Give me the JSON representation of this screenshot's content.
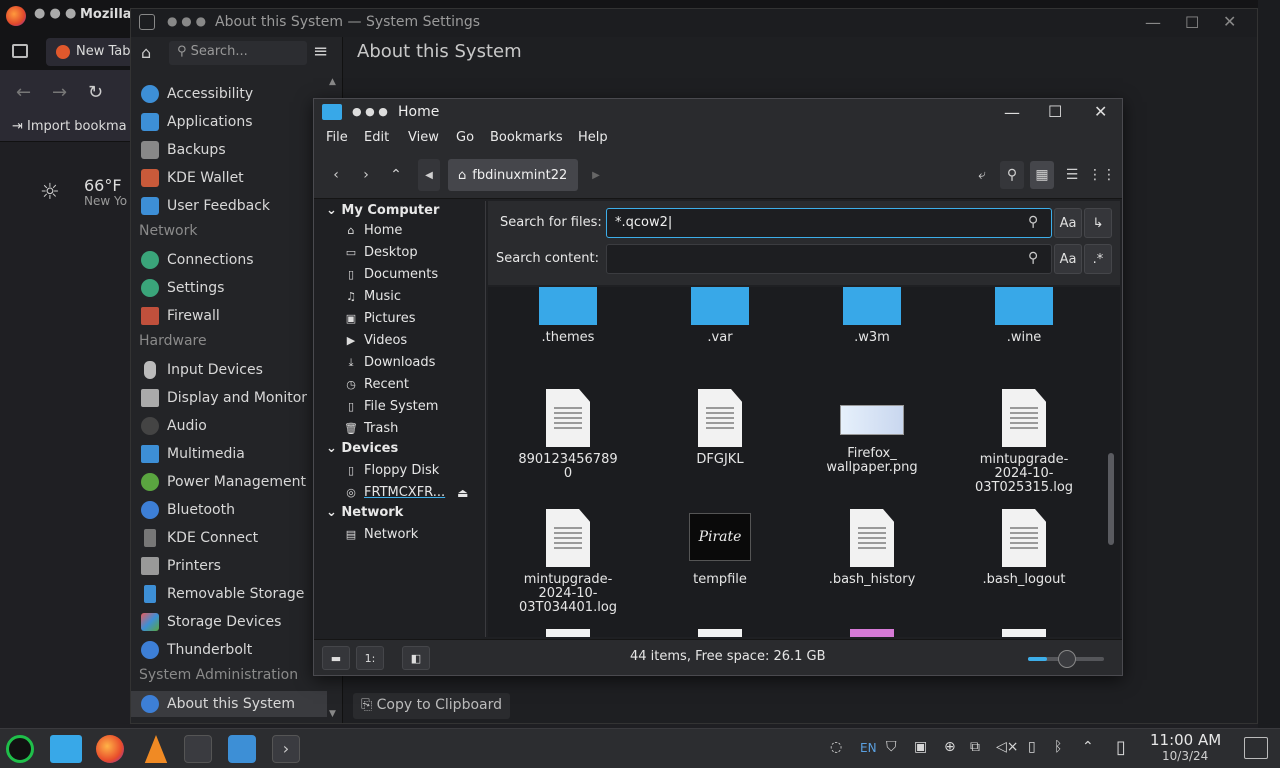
{
  "firefox": {
    "window_title": "Mozilla F",
    "tab_label": "New Tab",
    "bookmark_label": "Import bookma",
    "weather_temp": "66°F",
    "weather_place": "New Yo"
  },
  "settings": {
    "window_title": "About this System — System Settings",
    "search_placeholder": "Search...",
    "page_title": "About this System",
    "copy_button": "Copy to Clipboard",
    "sidebar": {
      "top_items": [
        "Accessibility",
        "Applications",
        "Backups",
        "KDE Wallet",
        "User Feedback"
      ],
      "network_label": "Network",
      "network_items": [
        "Connections",
        "Settings",
        "Firewall"
      ],
      "hardware_label": "Hardware",
      "hardware_items": [
        "Input Devices",
        "Display and Monitor",
        "Audio",
        "Multimedia",
        "Power Management",
        "Bluetooth",
        "KDE Connect",
        "Printers",
        "Removable Storage",
        "Storage Devices",
        "Thunderbolt"
      ],
      "sysadmin_label": "System Administration",
      "active_item": "About this System"
    }
  },
  "dolphin": {
    "window_title": "Home",
    "menu": [
      "File",
      "Edit",
      "View",
      "Go",
      "Bookmarks",
      "Help"
    ],
    "breadcrumb": "fbdinuxmint22",
    "places": {
      "my_computer": "My Computer",
      "items": [
        "Home",
        "Desktop",
        "Documents",
        "Music",
        "Pictures",
        "Videos",
        "Downloads",
        "Recent",
        "File System",
        "Trash"
      ],
      "devices_label": "Devices",
      "devices": [
        "Floppy Disk",
        "FRTMCXFR..."
      ],
      "network_label": "Network",
      "network_items": [
        "Network"
      ]
    },
    "search": {
      "files_label": "Search for files:",
      "files_value": "*.qcow2",
      "content_label": "Search content:",
      "content_value": "",
      "case_label": "Aa",
      "regex_label": ".*"
    },
    "files": {
      "row1": [
        ".themes",
        ".var",
        ".w3m",
        ".wine"
      ],
      "row2": [
        "8901234567890",
        "DFGJKL",
        "Firefox_\nwallpaper.png",
        "mintupgrade-\n2024-10-\n03T025315.log"
      ],
      "row3": [
        "mintupgrade-\n2024-10-\n03T034401.log",
        "tempfile",
        ".bash_history",
        ".bash_logout"
      ]
    },
    "status_text": "44 items, Free space: 26.1 GB",
    "zoom_level": 0.25
  },
  "taskbar": {
    "lang": "EN",
    "time": "11:00 AM",
    "date": "10/3/24"
  },
  "colors": {
    "accent": "#3daee9",
    "folder": "#38a8e8"
  }
}
